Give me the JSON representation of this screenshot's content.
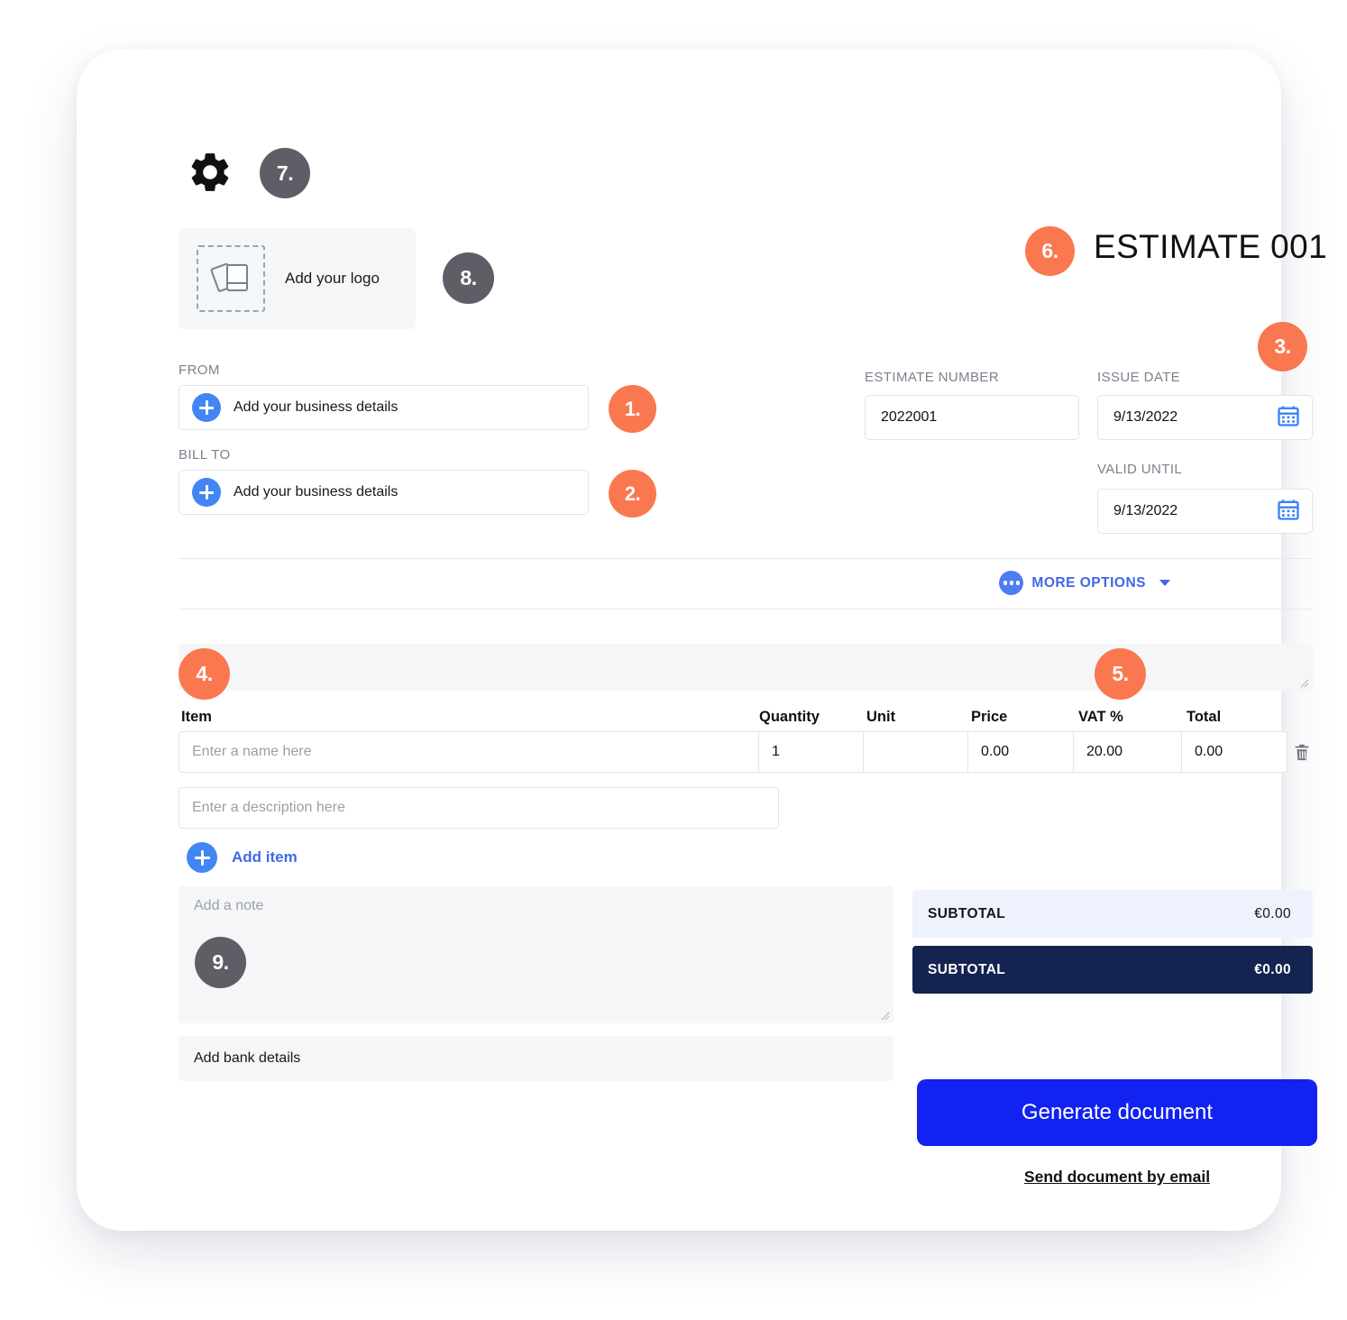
{
  "colors": {
    "badge_orange": "#fa7850",
    "badge_gray": "#5e5e66",
    "accent_blue": "#4285f4",
    "primary_button": "#1222f0",
    "total_dark": "#14234f",
    "total_light": "#eef2fd"
  },
  "header": {
    "gear_icon": "gear-icon",
    "badge_7": "7.",
    "logo_placeholder": "Add your logo",
    "logo_icon": "image-stack-icon",
    "badge_8": "8.",
    "badge_6": "6.",
    "document_title": "ESTIMATE 001",
    "badge_3": "3."
  },
  "parties": {
    "from_label": "FROM",
    "from_value": "Add your business details",
    "badge_1": "1.",
    "bill_to_label": "BILL TO",
    "bill_to_value": "Add your business details",
    "badge_2": "2."
  },
  "meta": {
    "estimate_number_label": "ESTIMATE NUMBER",
    "estimate_number_value": "2022001",
    "issue_date_label": "ISSUE DATE",
    "issue_date_value": "9/13/2022",
    "valid_until_label": "VALID UNTIL",
    "valid_until_value": "9/13/2022",
    "calendar_icon": "calendar-icon"
  },
  "more_options": {
    "label": "MORE OPTIONS",
    "dots_icon": "ellipsis-icon",
    "caret_icon": "chevron-down-icon"
  },
  "items": {
    "badge_4": "4.",
    "badge_5": "5.",
    "columns": [
      "Item",
      "Quantity",
      "Unit",
      "Price",
      "VAT %",
      "Total"
    ],
    "rows": [
      {
        "item_placeholder": "Enter a name here",
        "quantity": "1",
        "unit": "",
        "price": "0.00",
        "vat": "20.00",
        "total": "0.00",
        "description_placeholder": "Enter a description here",
        "delete_icon": "trash-icon"
      }
    ],
    "add_item_label": "Add item"
  },
  "note": {
    "placeholder": "Add a note",
    "badge_9": "9.",
    "bank_label": "Add bank details"
  },
  "totals": [
    {
      "label": "SUBTOTAL",
      "value": "€0.00"
    },
    {
      "label": "SUBTOTAL",
      "value": "€0.00"
    }
  ],
  "actions": {
    "generate_label": "Generate document",
    "send_email_label": "Send document by email"
  }
}
